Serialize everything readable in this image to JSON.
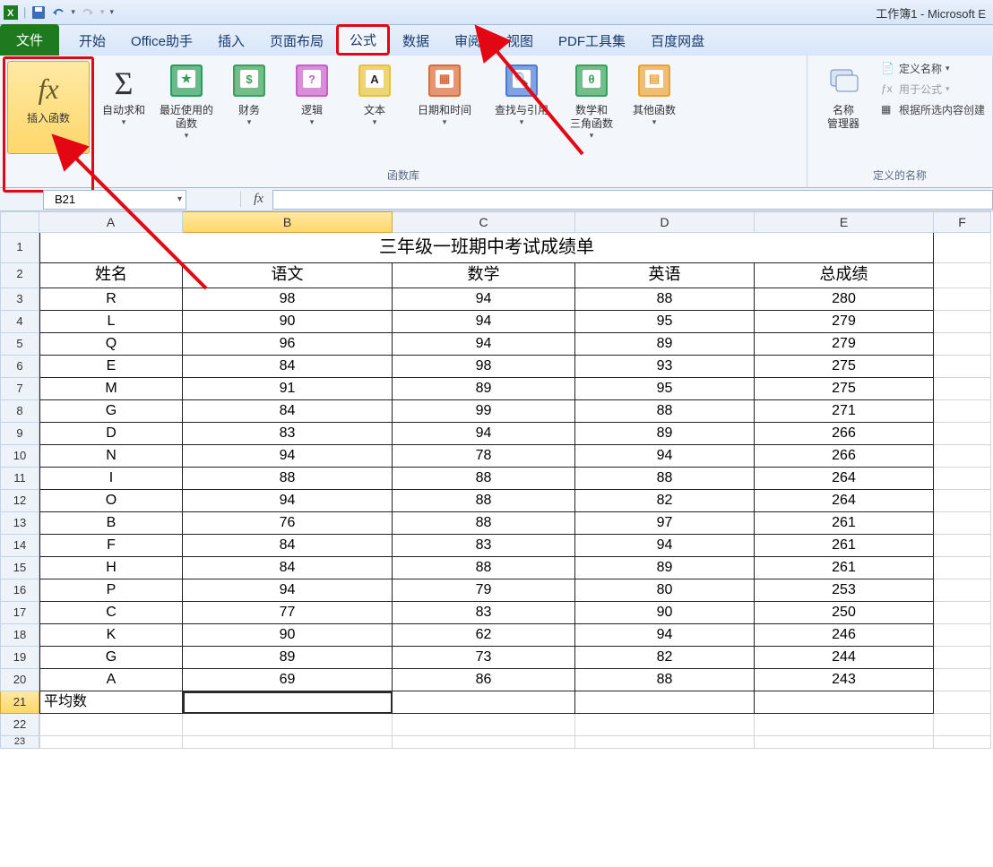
{
  "app_title": "工作簿1 - Microsoft E",
  "tabs": {
    "file": "文件",
    "home": "开始",
    "assistant": "Office助手",
    "insert": "插入",
    "layout": "页面布局",
    "formulas": "公式",
    "data": "数据",
    "review": "审阅",
    "view": "视图",
    "pdf": "PDF工具集",
    "baidu": "百度网盘"
  },
  "ribbon": {
    "insert_fn": "插入函数",
    "autosum": "自动求和",
    "recent": "最近使用的\n函数",
    "finance": "财务",
    "logic": "逻辑",
    "text": "文本",
    "datetime": "日期和时间",
    "lookup": "查找与引用",
    "math": "数学和\n三角函数",
    "other": "其他函数",
    "name_mgr": "名称\n管理器",
    "define_name": "定义名称",
    "use_formula": "用于公式",
    "create_sel": "根据所选内容创建",
    "group_lib": "函数库",
    "group_names": "定义的名称"
  },
  "namebox": "B21",
  "columns": [
    "A",
    "B",
    "C",
    "D",
    "E",
    "F"
  ],
  "sheet_title": "三年级一班期中考试成绩单",
  "headers": [
    "姓名",
    "语文",
    "数学",
    "英语",
    "总成绩"
  ],
  "rows": [
    {
      "n": "R",
      "a": 98,
      "b": 94,
      "c": 88,
      "t": 280
    },
    {
      "n": "L",
      "a": 90,
      "b": 94,
      "c": 95,
      "t": 279
    },
    {
      "n": "Q",
      "a": 96,
      "b": 94,
      "c": 89,
      "t": 279
    },
    {
      "n": "E",
      "a": 84,
      "b": 98,
      "c": 93,
      "t": 275
    },
    {
      "n": "M",
      "a": 91,
      "b": 89,
      "c": 95,
      "t": 275
    },
    {
      "n": "G",
      "a": 84,
      "b": 99,
      "c": 88,
      "t": 271
    },
    {
      "n": "D",
      "a": 83,
      "b": 94,
      "c": 89,
      "t": 266
    },
    {
      "n": "N",
      "a": 94,
      "b": 78,
      "c": 94,
      "t": 266
    },
    {
      "n": "I",
      "a": 88,
      "b": 88,
      "c": 88,
      "t": 264
    },
    {
      "n": "O",
      "a": 94,
      "b": 88,
      "c": 82,
      "t": 264
    },
    {
      "n": "B",
      "a": 76,
      "b": 88,
      "c": 97,
      "t": 261
    },
    {
      "n": "F",
      "a": 84,
      "b": 83,
      "c": 94,
      "t": 261
    },
    {
      "n": "H",
      "a": 84,
      "b": 88,
      "c": 89,
      "t": 261
    },
    {
      "n": "P",
      "a": 94,
      "b": 79,
      "c": 80,
      "t": 253
    },
    {
      "n": "C",
      "a": 77,
      "b": 83,
      "c": 90,
      "t": 250
    },
    {
      "n": "K",
      "a": 90,
      "b": 62,
      "c": 94,
      "t": 246
    },
    {
      "n": "G",
      "a": 89,
      "b": 73,
      "c": 82,
      "t": 244
    },
    {
      "n": "A",
      "a": 69,
      "b": 86,
      "c": 88,
      "t": 243
    }
  ],
  "avg_label": "平均数"
}
